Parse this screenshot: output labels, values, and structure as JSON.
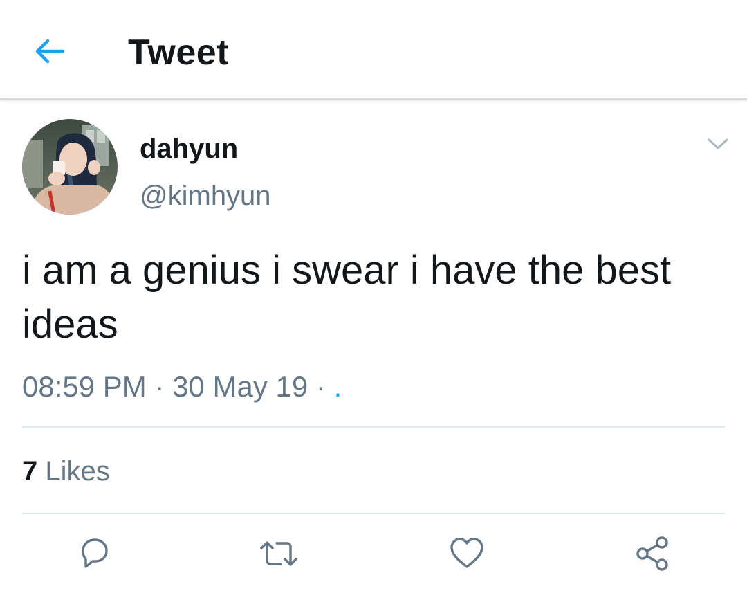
{
  "header": {
    "title": "Tweet",
    "back_icon": "arrow-left-icon",
    "accent_color": "#1da1f2"
  },
  "tweet": {
    "author": {
      "display_name": "dahyun",
      "handle": "@kimhyun"
    },
    "text": "i am a genius i swear i have the best ideas",
    "time": "08:59 PM",
    "separator": "·",
    "date": "30 May 19",
    "source_dot": ".",
    "likes": {
      "count": "7",
      "label": "Likes"
    }
  },
  "actions": [
    {
      "icon": "reply-icon"
    },
    {
      "icon": "retweet-icon"
    },
    {
      "icon": "heart-icon"
    },
    {
      "icon": "share-icon"
    }
  ],
  "colors": {
    "text_primary": "#14171a",
    "text_secondary": "#657786",
    "divider": "#e1e8ed",
    "accent": "#1da1f2"
  }
}
